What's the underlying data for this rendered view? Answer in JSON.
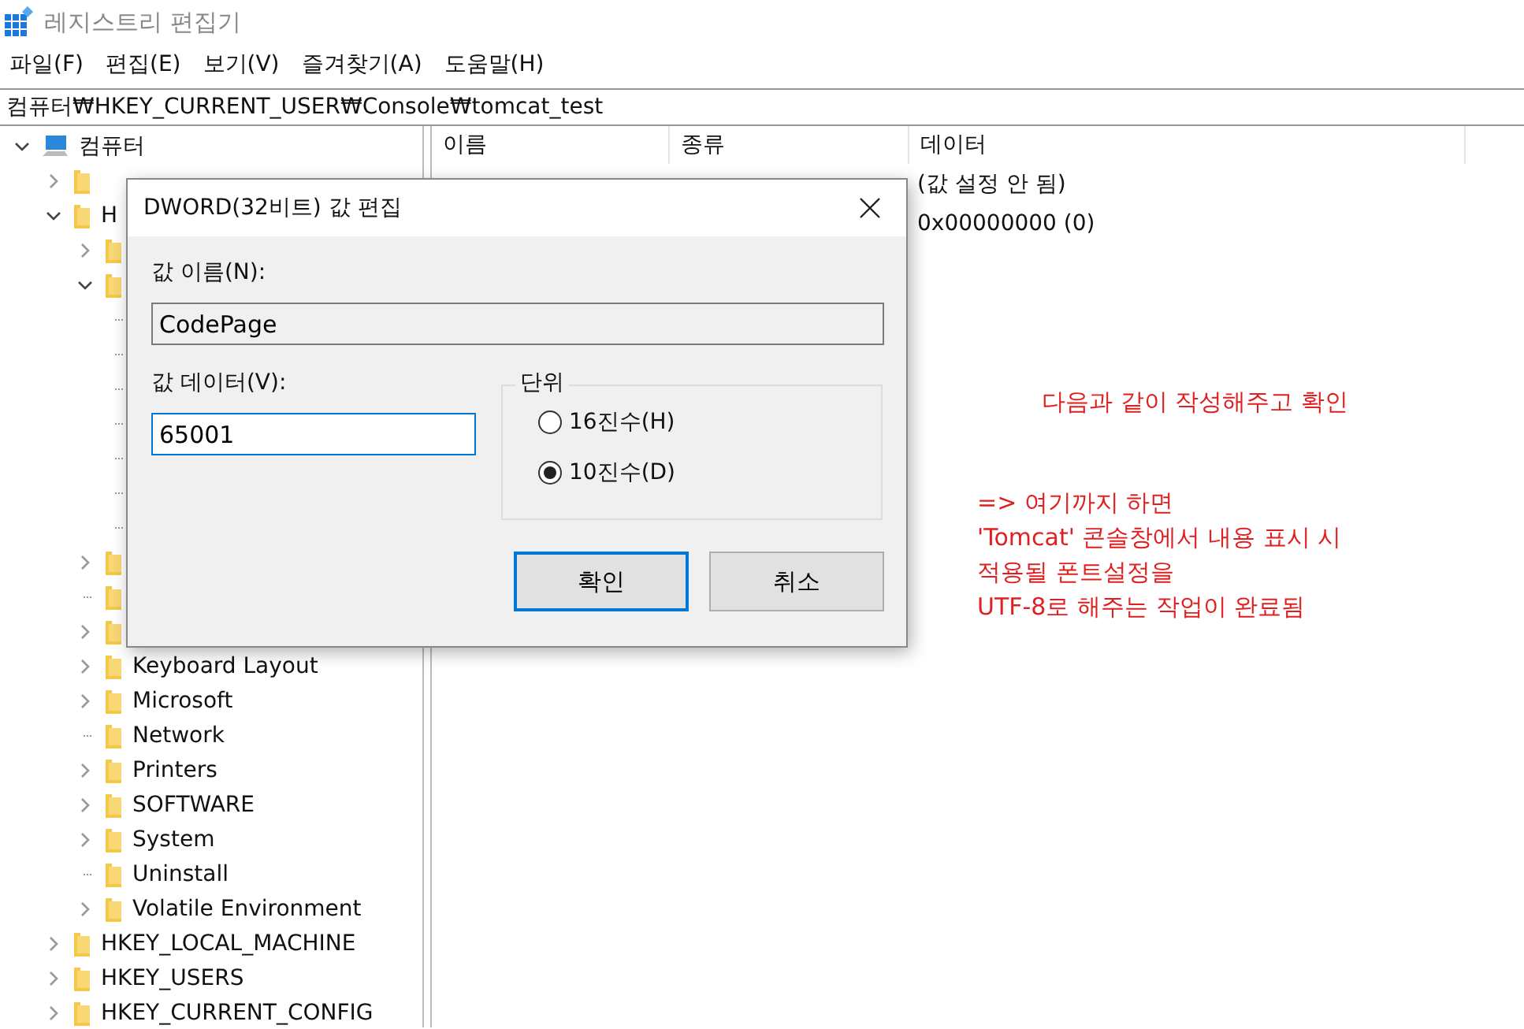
{
  "window": {
    "title": "레지스트리 편집기"
  },
  "menu": [
    "파일(F)",
    "편집(E)",
    "보기(V)",
    "즐겨찾기(A)",
    "도움말(H)"
  ],
  "address": "컴퓨터₩HKEY_CURRENT_USER₩Console₩tomcat_test",
  "tree": [
    {
      "kind": "computer",
      "label": "컴퓨터",
      "expandable": true,
      "expanded": true,
      "children": [
        {
          "kind": "folder",
          "expandable": true,
          "expanded": false
        },
        {
          "kind": "folder",
          "label": "H",
          "expandable": true,
          "expanded": true,
          "children": [
            {
              "kind": "folder",
              "expandable": true,
              "expanded": false
            },
            {
              "kind": "folder",
              "expandable": true,
              "expanded": true,
              "children": [
                {
                  "expandable": false,
                  "expanded": false
                },
                {
                  "expandable": false,
                  "expanded": false
                },
                {
                  "expandable": false,
                  "expanded": false
                },
                {
                  "expandable": false,
                  "expanded": false
                },
                {
                  "expandable": false,
                  "expanded": false
                },
                {
                  "expandable": false,
                  "expanded": false
                },
                {
                  "expandable": false,
                  "expanded": false
                }
              ]
            },
            {
              "kind": "folder",
              "expandable": true,
              "expanded": false
            },
            {
              "kind": "folder",
              "expandable": false,
              "expanded": false
            },
            {
              "kind": "folder",
              "expandable": true,
              "expanded": false
            },
            {
              "kind": "folder",
              "label": "Keyboard Layout",
              "expandable": true,
              "expanded": false
            },
            {
              "kind": "folder",
              "label": "Microsoft",
              "expandable": true,
              "expanded": false
            },
            {
              "kind": "folder",
              "label": "Network",
              "expandable": false,
              "expanded": false
            },
            {
              "kind": "folder",
              "label": "Printers",
              "expandable": true,
              "expanded": false
            },
            {
              "kind": "folder",
              "label": "SOFTWARE",
              "expandable": true,
              "expanded": false
            },
            {
              "kind": "folder",
              "label": "System",
              "expandable": true,
              "expanded": false
            },
            {
              "kind": "folder",
              "label": "Uninstall",
              "expandable": false,
              "expanded": false
            },
            {
              "kind": "folder",
              "label": "Volatile Environment",
              "expandable": true,
              "expanded": false
            }
          ]
        },
        {
          "kind": "folder",
          "label": "HKEY_LOCAL_MACHINE",
          "expandable": true,
          "expanded": false
        },
        {
          "kind": "folder",
          "label": "HKEY_USERS",
          "expandable": true,
          "expanded": false
        },
        {
          "kind": "folder",
          "label": "HKEY_CURRENT_CONFIG",
          "expandable": true,
          "expanded": false
        }
      ]
    }
  ],
  "list": {
    "columns": [
      "이름",
      "종류",
      "데이터"
    ],
    "rows": [
      {
        "data": "(값 설정 안 됨)"
      },
      {
        "data": "0x00000000 (0)"
      }
    ]
  },
  "dialog": {
    "title": "DWORD(32비트) 값 편집",
    "name_label": "값 이름(N):",
    "name_value": "CodePage",
    "data_label": "값 데이터(V):",
    "data_value": "65001",
    "group_label": "단위",
    "radios": [
      {
        "label": "16진수(H)",
        "selected": false
      },
      {
        "label": "10진수(D)",
        "selected": true
      }
    ],
    "buttons": [
      {
        "label": "확인",
        "default": true
      },
      {
        "label": "취소",
        "default": false
      }
    ]
  },
  "annotations": [
    {
      "lines": [
        "다음과 같이 작성해주고 확인"
      ]
    },
    {
      "lines": [
        "=> 여기까지 하면",
        "'Tomcat' 콘솔창에서 내용 표시 시",
        "적용될 폰트설정을",
        "UTF-8로 해주는 작업이 완료됨"
      ]
    }
  ]
}
